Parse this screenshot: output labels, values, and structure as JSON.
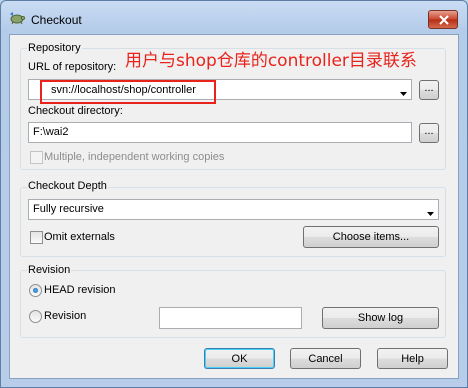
{
  "window": {
    "title": "Checkout",
    "close_icon": "close-icon"
  },
  "repository": {
    "group_label": "Repository",
    "url_label": "URL of repository:",
    "url_value": "svn://localhost/shop/controller",
    "browse_url_label": "...",
    "dir_label": "Checkout directory:",
    "dir_value": "F:\\wai2",
    "browse_dir_label": "...",
    "multiple_label": "Multiple, independent working copies",
    "multiple_checked": false
  },
  "annotation": {
    "text": "用户与shop仓库的controller目录联系",
    "color": "#e8231c"
  },
  "depth": {
    "group_label": "Checkout Depth",
    "selected": "Fully recursive",
    "omit_externals_label": "Omit externals",
    "omit_externals_checked": false,
    "choose_items_label": "Choose items..."
  },
  "revision": {
    "group_label": "Revision",
    "head_label": "HEAD revision",
    "head_selected": true,
    "revision_label": "Revision",
    "revision_value": "",
    "show_log_label": "Show log"
  },
  "buttons": {
    "ok": "OK",
    "cancel": "Cancel",
    "help": "Help"
  }
}
